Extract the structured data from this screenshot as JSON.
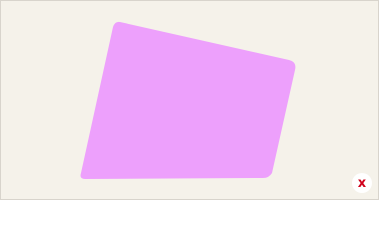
{
  "canvas": {
    "background": "#f5f2ea",
    "border_color": "#d8d4cc"
  },
  "shape": {
    "kind": "quadrilateral",
    "fill": "#eda0fc"
  },
  "close_button": {
    "icon": "close-icon",
    "glyph": "x",
    "color": "#d0021b",
    "background": "#ffffff"
  }
}
